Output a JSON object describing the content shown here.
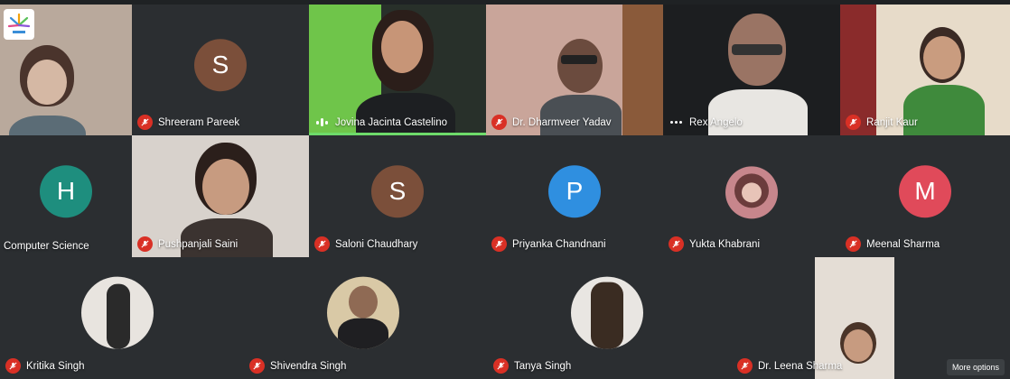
{
  "participants": {
    "row1": [
      {
        "name": ""
      },
      {
        "name": "Shreeram Pareek",
        "initial": "S",
        "color": "#7b4f3a"
      },
      {
        "name": "Jovina Jacinta Castelino"
      },
      {
        "name": "Dr. Dharmveer Yadav"
      },
      {
        "name": "Rex Angelo"
      },
      {
        "name": "Ranjit Kaur"
      }
    ],
    "row2": [
      {
        "name": "Computer Science",
        "initial": "H",
        "color": "#1e8e7e"
      },
      {
        "name": "Pushpanjali Saini"
      },
      {
        "name": "Saloni Chaudhary",
        "initial": "S",
        "color": "#7b4f3a"
      },
      {
        "name": "Priyanka Chandnani",
        "initial": "P",
        "color": "#2f8fe0"
      },
      {
        "name": "Yukta Khabrani"
      },
      {
        "name": "Meenal Sharma",
        "initial": "M",
        "color": "#e04a5a"
      }
    ],
    "row3": [
      {
        "name": "Kritika Singh"
      },
      {
        "name": "Shivendra Singh"
      },
      {
        "name": "Tanya Singh"
      },
      {
        "name": "Dr. Leena Sharma"
      }
    ]
  },
  "controls": {
    "more_options": "More options"
  },
  "icons": {
    "mic_off": "mic-off-icon",
    "speaking": "speaking-indicator-icon",
    "more": "more-dots-icon",
    "logo": "app-logo-icon"
  },
  "colors": {
    "mic_off": "#d93025",
    "active_speaker": "#6edb6a"
  }
}
